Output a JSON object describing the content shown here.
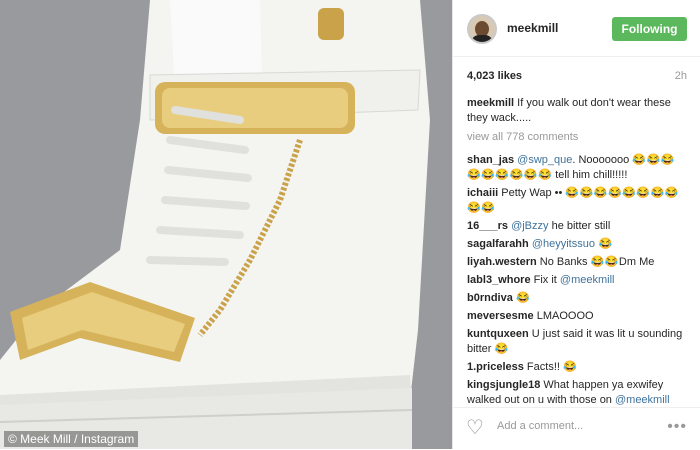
{
  "photo": {
    "credit": "© Meek Mill / Instagram"
  },
  "header": {
    "username": "meekmill",
    "follow_label": "Following"
  },
  "post": {
    "likes": "4,023 likes",
    "time": "2h"
  },
  "caption": {
    "user": "meekmill",
    "text": "If you walk out don't wear these they wack....."
  },
  "view_all": "view all 778 comments",
  "comments": [
    {
      "user": "shan_jas",
      "mention": "@swp_que",
      "text": ". Nooooooo",
      "emoji": "😂😂😂😂😂😂😂😂😂",
      "text2": " tell him chill!!!!!"
    },
    {
      "user": "ichaiii",
      "text": " Petty Wap ••",
      "emoji": "😂😂😂😂😂😂😂😂😂😂"
    },
    {
      "user": "16___rs",
      "mention": "@jBzzy",
      "text": " he bitter still"
    },
    {
      "user": "sagalfarahh",
      "mention": "@heyyitssuo",
      "emoji": " 😂"
    },
    {
      "user": "liyah.western",
      "text": " No Banks ",
      "emoji": "😂😂",
      "text2": "Dm Me"
    },
    {
      "user": "labl3_whore",
      "text": " Fix it ",
      "mention": "@meekmill"
    },
    {
      "user": "b0rndiva",
      "emoji": " 😂"
    },
    {
      "user": "meversesme",
      "text": " LMAOOOO"
    },
    {
      "user": "kuntquxeen",
      "text": " U just said it was lit u sounding bitter ",
      "emoji": "😂"
    },
    {
      "user": "1.priceless",
      "text": " Facts!! ",
      "emoji": "😂"
    },
    {
      "user": "kingsjungle18",
      "text": " What happen ya exwifey walked out on u with those on ",
      "mention": "@meekmill"
    }
  ],
  "footer": {
    "add_comment_placeholder": "Add a comment...",
    "more": "•••"
  },
  "colors": {
    "follow_green": "#5cb85c",
    "mention_blue": "#3f729b",
    "emoji_gold": "#d7a21f"
  }
}
